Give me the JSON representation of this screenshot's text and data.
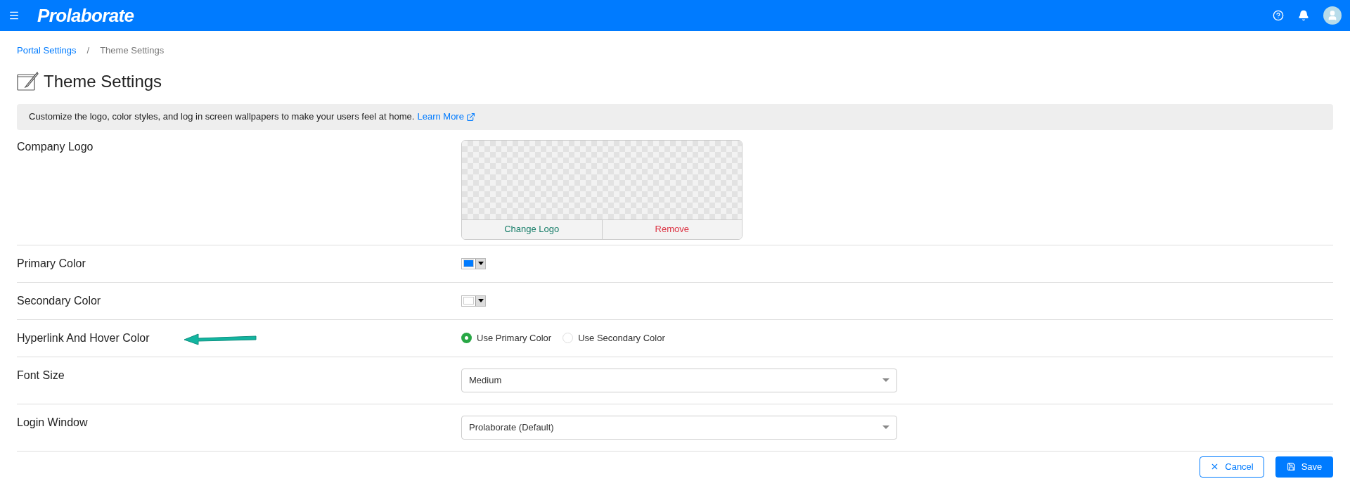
{
  "header": {
    "brand": "Prolaborate"
  },
  "breadcrumb": [
    {
      "label": "Portal Settings",
      "kind": "link"
    },
    {
      "label": "/",
      "kind": "separator"
    },
    {
      "label": "Theme Settings",
      "kind": "current"
    }
  ],
  "page_title": "Theme Settings",
  "info": {
    "text": "Customize the logo, color styles, and log in screen wallpapers to make your users feel at home.",
    "link": "Learn More"
  },
  "rows": [
    {
      "kind": "logo",
      "label": "Company Logo",
      "actions": [
        {
          "label": "Change Logo",
          "kind": "change"
        },
        {
          "label": "Remove",
          "kind": "remove"
        }
      ]
    },
    {
      "kind": "color",
      "label": "Primary Color",
      "color": "#007bff"
    },
    {
      "kind": "color",
      "label": "Secondary Color",
      "color": "#ffffff"
    },
    {
      "kind": "radio",
      "label": "Hyperlink And Hover Color",
      "annotated": true,
      "options": [
        {
          "label": "Use Primary Color",
          "selected": true
        },
        {
          "label": "Use Secondary Color",
          "selected": false
        }
      ]
    },
    {
      "kind": "select",
      "label": "Font Size",
      "value": "Medium"
    },
    {
      "kind": "select",
      "label": "Login Window",
      "value": "Prolaborate (Default)"
    }
  ],
  "buttons": [
    {
      "label": "Cancel",
      "kind": "cancel"
    },
    {
      "label": "Save",
      "kind": "save"
    }
  ]
}
